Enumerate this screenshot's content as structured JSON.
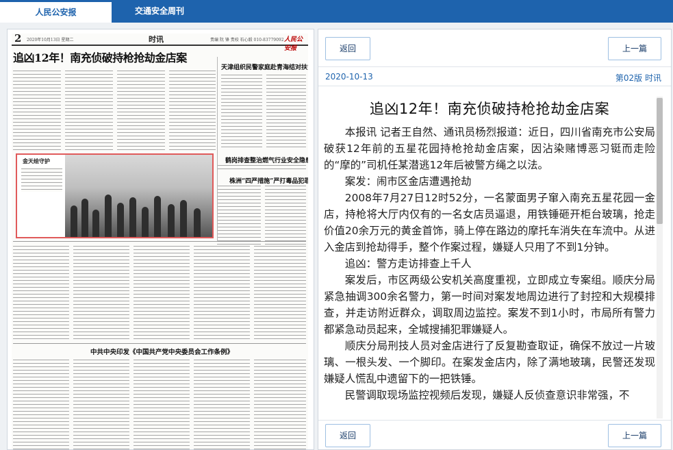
{
  "tabs": [
    {
      "label": "人民公安报"
    },
    {
      "label": "交通安全周刊"
    }
  ],
  "newspaper": {
    "page_no": "2",
    "date_line": "2020年10月13日 星期二",
    "section": "时讯",
    "editor_line": "责编 阮 锋 责校 石心毅 010-83779092",
    "logo": "人民公安报",
    "headline": "追凶12年！南充侦破持枪抢劫金店案",
    "side_headlines": [
      "天津组织民警家庭赴青海结对扶贫",
      "鹤岗排查整治燃气行业安全隐患",
      "株洲“四严措施”严打毒品犯罪"
    ],
    "photo_caption": "金天绘守护",
    "bottom_headline": "中共中央印发《中国共产党中央委员会工作条例》"
  },
  "toolbar": {
    "back_label": "返回",
    "prev_label": "上一篇"
  },
  "meta": {
    "date": "2020-10-13",
    "page": "第02版 时讯"
  },
  "article": {
    "title": "追凶12年！南充侦破持枪抢劫金店案",
    "paragraphs": [
      "本报讯 记者王自然、通讯员杨烈报道：近日，四川省南充市公安局破获12年前的五星花园持枪抢劫金店案，因沾染赌博恶习铤而走险的“摩的”司机任某潜逃12年后被警方绳之以法。",
      "案发：闹市区金店遭遇抢劫",
      "2008年7月27日12时52分，一名蒙面男子窜入南充五星花园一金店，持枪将大厅内仅有的一名女店员逼退，用铁锤砸开柜台玻璃，抢走价值20余万元的黄金首饰，骑上停在路边的摩托车消失在车流中。从进入金店到抢劫得手，整个作案过程，嫌疑人只用了不到1分钟。",
      "追凶：警方走访排查上千人",
      "案发后，市区两级公安机关高度重视，立即成立专案组。顺庆分局紧急抽调300余名警力，第一时间对案发地周边进行了封控和大规模排查，并走访附近群众，调取周边监控。案发不到1小时，市局所有警力都紧急动员起来，全城搜捕犯罪嫌疑人。",
      "顺庆分局刑技人员对金店进行了反复勘查取证，确保不放过一片玻璃、一根头发、一个脚印。在案发金店内，除了满地玻璃，民警还发现嫌疑人慌乱中遗留下的一把铁锤。",
      "民警调取现场监控视频后发现，嫌疑人反侦查意识非常强，不"
    ]
  }
}
